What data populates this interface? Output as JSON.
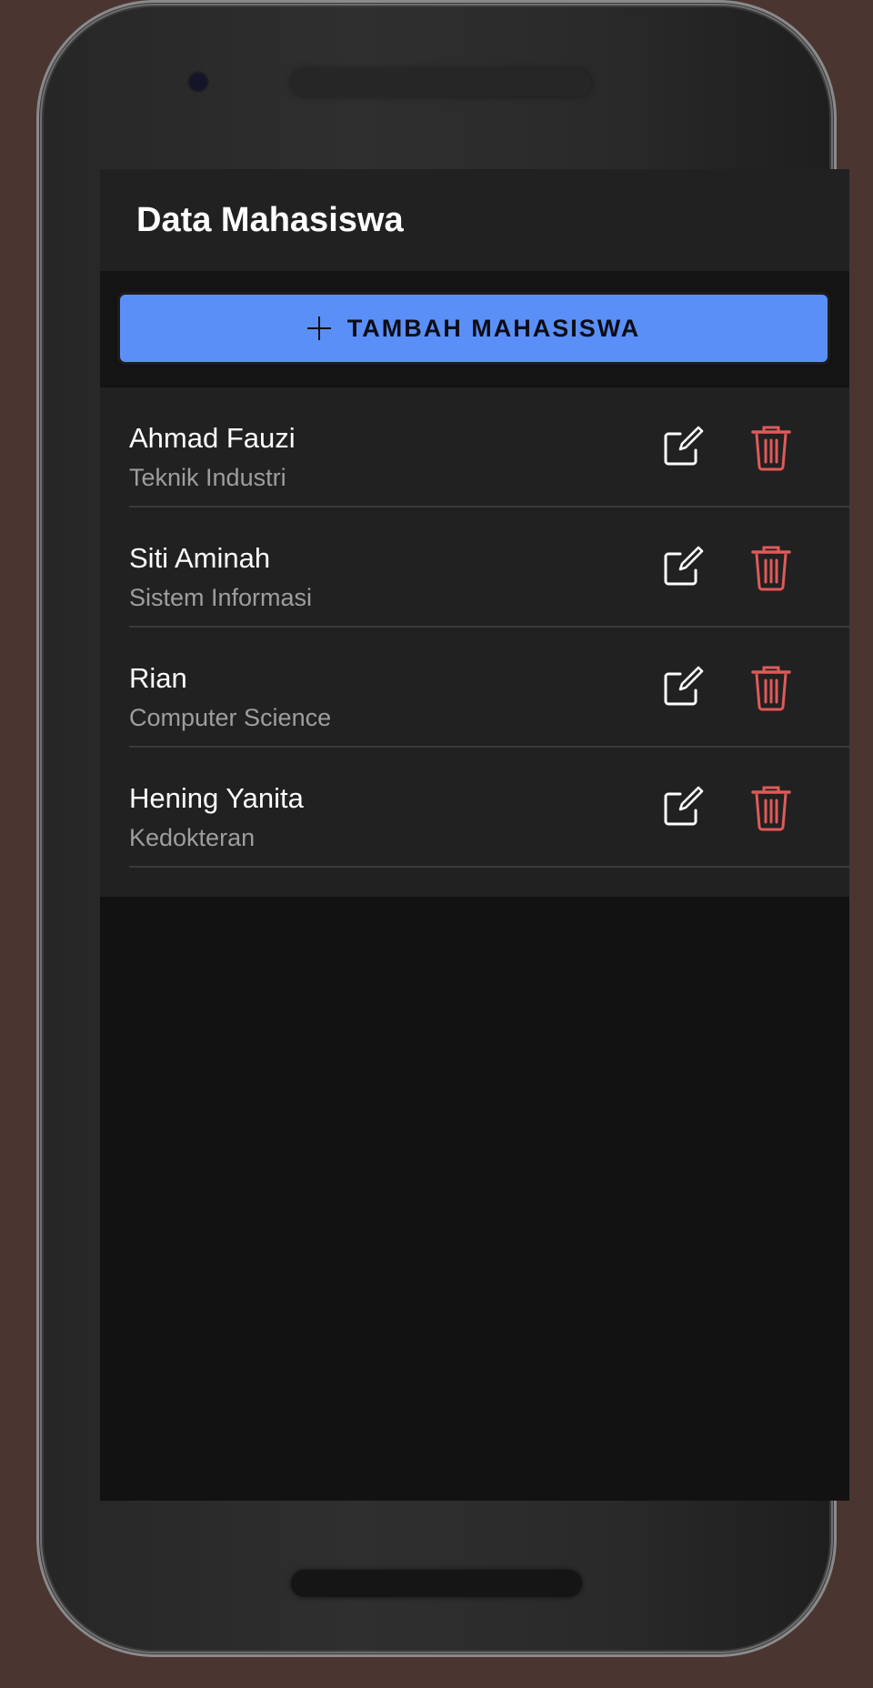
{
  "app": {
    "title": "Data Mahasiswa"
  },
  "actions": {
    "add_label": "TAMBAH MAHASISWA"
  },
  "students": [
    {
      "name": "Ahmad Fauzi",
      "major": "Teknik Industri"
    },
    {
      "name": "Siti Aminah",
      "major": "Sistem Informasi"
    },
    {
      "name": "Rian",
      "major": "Computer Science"
    },
    {
      "name": "Hening Yanita",
      "major": "Kedokteran"
    }
  ],
  "icons": {
    "add": "plus-icon",
    "edit": "edit-icon",
    "delete": "trash-icon"
  },
  "colors": {
    "primary": "#5b8ff8",
    "delete": "#e05a5a",
    "edit": "#ffffff",
    "surface": "#212121",
    "background": "#121212"
  }
}
